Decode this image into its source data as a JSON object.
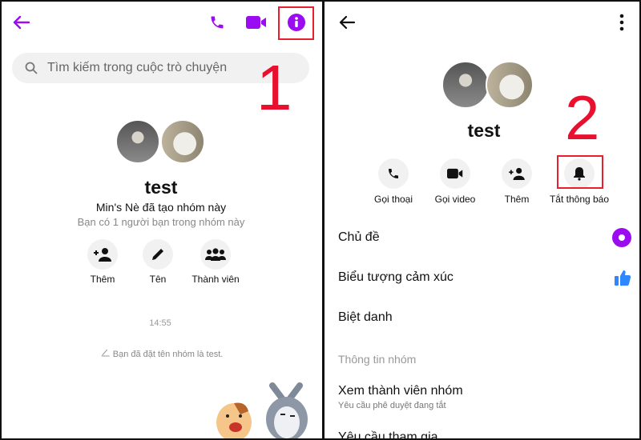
{
  "colors": {
    "accent": "#9b0cf0",
    "annotation": "#e8102e",
    "like": "#2d88ff"
  },
  "left": {
    "icons": [
      "back-arrow-icon",
      "phone-icon",
      "video-icon",
      "info-icon"
    ],
    "search_placeholder": "Tìm kiếm trong cuộc trò chuyện",
    "annotation": "1",
    "group_name": "test",
    "created_text": "Min's Nè đã tạo nhóm này",
    "friends_text": "Bạn có 1 người bạn trong nhóm này",
    "actions": [
      {
        "label": "Thêm",
        "icon": "add-person-icon"
      },
      {
        "label": "Tên",
        "icon": "pencil-icon"
      },
      {
        "label": "Thành viên",
        "icon": "group-icon"
      }
    ],
    "timestamp": "14:55",
    "system_message": "Bạn đã đặt tên nhóm là test."
  },
  "right": {
    "icons": [
      "back-arrow-icon",
      "more-vertical-icon"
    ],
    "group_name": "test",
    "annotation": "2",
    "actions": [
      {
        "label": "Gọi thoại",
        "icon": "phone-icon"
      },
      {
        "label": "Gọi video",
        "icon": "video-icon"
      },
      {
        "label": "Thêm",
        "icon": "add-person-icon"
      },
      {
        "label": "Tắt thông báo",
        "icon": "bell-icon"
      }
    ],
    "items": [
      {
        "label": "Chủ đề"
      },
      {
        "label": "Biểu tượng cảm xúc"
      },
      {
        "label": "Biệt danh"
      }
    ],
    "section": "Thông tin nhóm",
    "members": {
      "label": "Xem thành viên nhóm",
      "sub": "Yêu cầu phê duyệt đang tắt"
    },
    "requests": "Yêu cầu tham gia"
  }
}
